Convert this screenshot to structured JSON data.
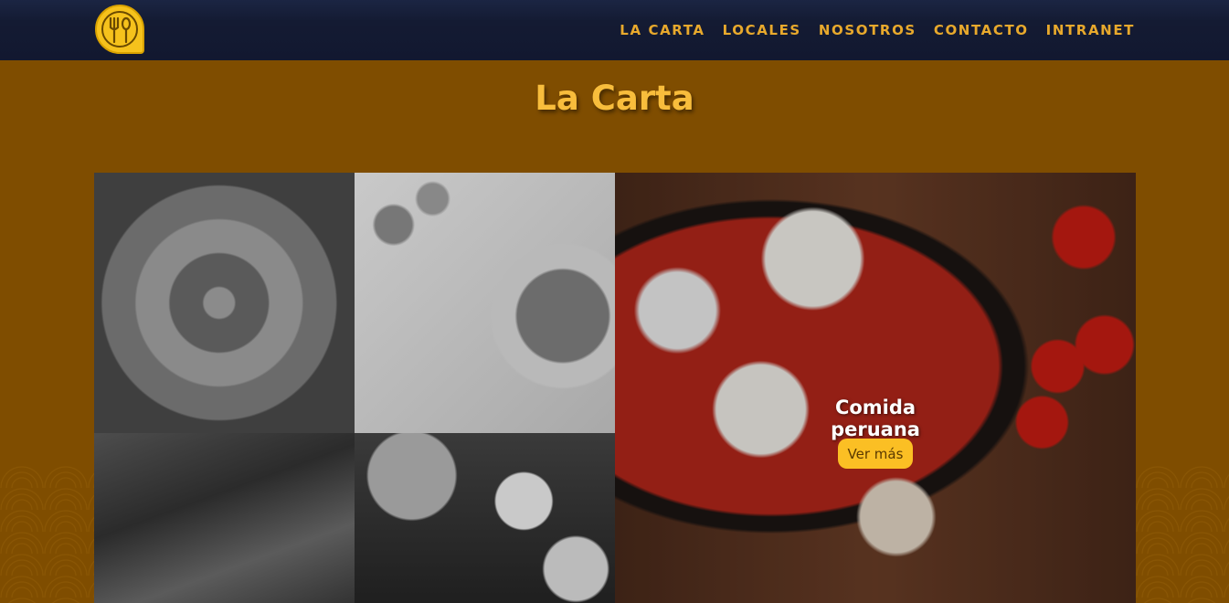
{
  "brand": {
    "logo_icon": "fork-spoon-icon"
  },
  "nav": {
    "items": [
      "LA CARTA",
      "LOCALES",
      "NOSOTROS",
      "CONTACTO",
      "INTRANET"
    ]
  },
  "page": {
    "title": "La Carta"
  },
  "featured": {
    "caption": "Comida peruana",
    "button_label": "Ver más"
  },
  "colors": {
    "background": "#7f4d00",
    "header": "#141b33",
    "accent": "#fbbf24",
    "nav_text": "#e8a92c",
    "title": "#f8bd3c"
  }
}
